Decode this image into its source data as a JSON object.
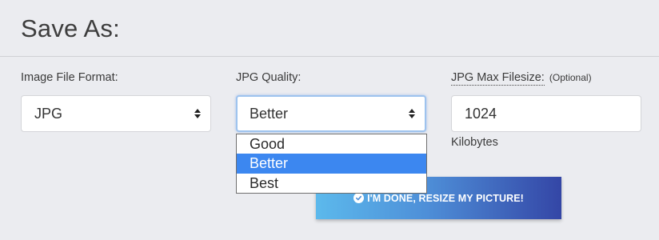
{
  "title": "Save As:",
  "format": {
    "label": "Image File Format:",
    "value": "JPG"
  },
  "quality": {
    "label": "JPG Quality:",
    "value": "Better",
    "options": [
      "Good",
      "Better",
      "Best"
    ],
    "selected_index": 1
  },
  "filesize": {
    "label": "JPG Max Filesize:",
    "label_note": "(Optional)",
    "value": "1024",
    "unit": "Kilobytes"
  },
  "submit": {
    "label": "I'M DONE, RESIZE MY PICTURE!"
  },
  "colors": {
    "accent_selected": "#3c87f0",
    "button_gradient_start": "#5cb9ec",
    "button_gradient_end": "#3446a6",
    "background": "#ebecf0"
  }
}
